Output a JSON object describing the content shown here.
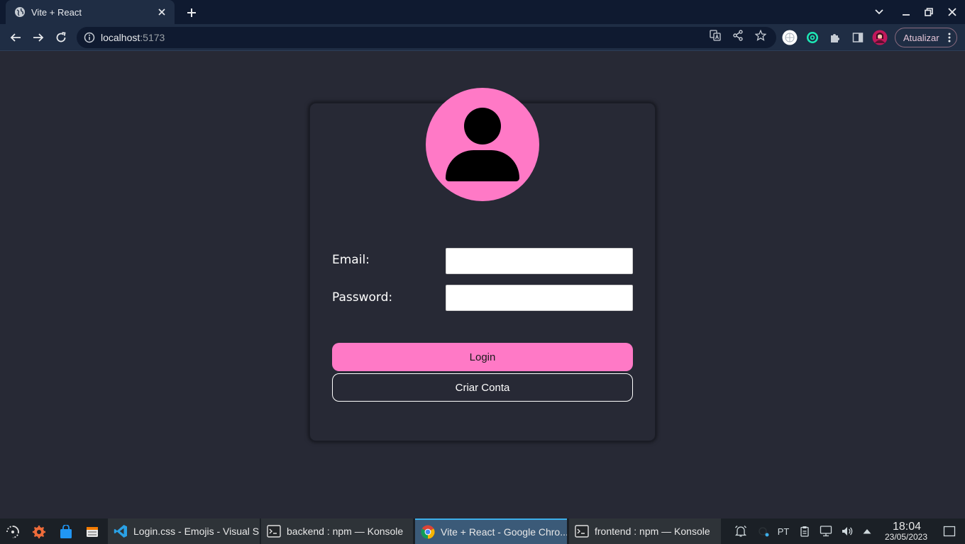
{
  "browser": {
    "tab_title": "Vite + React",
    "url_host": "localhost",
    "url_port": ":5173",
    "update_label": "Atualizar"
  },
  "login": {
    "email_label": "Email:",
    "email_value": "",
    "password_label": "Password:",
    "password_value": "",
    "login_button": "Login",
    "create_button": "Criar Conta"
  },
  "taskbar": {
    "tasks": [
      {
        "label": "Login.css - Emojis - Visual S...",
        "icon": "vscode-icon"
      },
      {
        "label": "backend : npm — Konsole",
        "icon": "terminal-icon"
      },
      {
        "label": "Vite + React - Google Chro...",
        "icon": "chrome-icon"
      },
      {
        "label": "frontend : npm — Konsole",
        "icon": "terminal-icon"
      }
    ],
    "keyboard_layout": "PT",
    "time": "18:04",
    "date": "23/05/2023"
  },
  "colors": {
    "accent_pink": "#ff79c6",
    "page_background": "#272935",
    "active_task": "#3b5a78"
  }
}
